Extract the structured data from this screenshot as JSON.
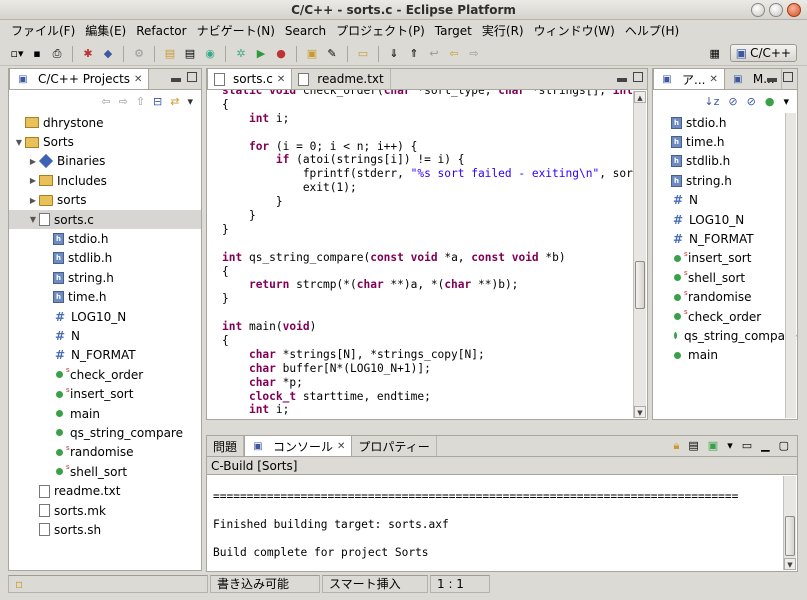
{
  "window": {
    "title": "C/C++ - sorts.c - Eclipse Platform"
  },
  "menubar": [
    "ファイル(F)",
    "編集(E)",
    "Refactor",
    "ナビゲート(N)",
    "Search",
    "プロジェクト(P)",
    "Target",
    "実行(R)",
    "ウィンドウ(W)",
    "ヘルプ(H)"
  ],
  "perspective": {
    "label": "C/C++"
  },
  "projects_view": {
    "title": "C/C++ Projects",
    "tree": [
      {
        "label": "dhrystone",
        "indent": 1,
        "icon": "project-icon",
        "twisty": ""
      },
      {
        "label": "Sorts",
        "indent": 1,
        "icon": "project-icon",
        "twisty": "▼"
      },
      {
        "label": "Binaries",
        "indent": 2,
        "icon": "binaries-icon",
        "twisty": "▶"
      },
      {
        "label": "Includes",
        "indent": 2,
        "icon": "includes-icon",
        "twisty": "▶"
      },
      {
        "label": "sorts",
        "indent": 2,
        "icon": "folder-icon",
        "twisty": "▶"
      },
      {
        "label": "sorts.c",
        "indent": 2,
        "icon": "c-file-icon",
        "twisty": "▼",
        "selected": true
      },
      {
        "label": "stdio.h",
        "indent": 3,
        "icon": "header-icon",
        "twisty": ""
      },
      {
        "label": "stdlib.h",
        "indent": 3,
        "icon": "header-icon",
        "twisty": ""
      },
      {
        "label": "string.h",
        "indent": 3,
        "icon": "header-icon",
        "twisty": ""
      },
      {
        "label": "time.h",
        "indent": 3,
        "icon": "header-icon",
        "twisty": ""
      },
      {
        "label": "LOG10_N",
        "indent": 3,
        "icon": "macro-icon",
        "twisty": ""
      },
      {
        "label": "N",
        "indent": 3,
        "icon": "macro-icon",
        "twisty": ""
      },
      {
        "label": "N_FORMAT",
        "indent": 3,
        "icon": "macro-icon",
        "twisty": ""
      },
      {
        "label": "check_order",
        "indent": 3,
        "icon": "static-function-icon",
        "twisty": ""
      },
      {
        "label": "insert_sort",
        "indent": 3,
        "icon": "static-function-icon",
        "twisty": ""
      },
      {
        "label": "main",
        "indent": 3,
        "icon": "function-icon",
        "twisty": ""
      },
      {
        "label": "qs_string_compare",
        "indent": 3,
        "icon": "function-icon",
        "twisty": ""
      },
      {
        "label": "randomise",
        "indent": 3,
        "icon": "static-function-icon",
        "twisty": ""
      },
      {
        "label": "shell_sort",
        "indent": 3,
        "icon": "static-function-icon",
        "twisty": ""
      },
      {
        "label": "readme.txt",
        "indent": 2,
        "icon": "text-file-icon",
        "twisty": ""
      },
      {
        "label": "sorts.mk",
        "indent": 2,
        "icon": "makefile-icon",
        "twisty": ""
      },
      {
        "label": "sorts.sh",
        "indent": 2,
        "icon": "script-file-icon",
        "twisty": ""
      }
    ]
  },
  "editor": {
    "tabs": [
      {
        "label": "sorts.c",
        "active": true
      },
      {
        "label": "readme.txt",
        "active": false
      }
    ],
    "lines": [
      "static void check_order(char *sort_type, char *strings[], int n)",
      "{",
      "    int i;",
      "",
      "    for (i = 0; i < n; i++) {",
      "        if (atoi(strings[i]) != i) {",
      "            fprintf(stderr, \"%s sort failed - exiting\\n\", sort_ty",
      "            exit(1);",
      "        }",
      "    }",
      "}",
      "",
      "int qs_string_compare(const void *a, const void *b)",
      "{",
      "    return strcmp(*(char **)a, *(char **)b);",
      "}",
      "",
      "int main(void)",
      "{",
      "    char *strings[N], *strings_copy[N];",
      "    char buffer[N*(LOG10_N+1)];",
      "    char *p;",
      "    clock_t starttime, endtime;",
      "    int i;"
    ]
  },
  "outline_view": {
    "tabs": [
      {
        "label": "ア..."
      },
      {
        "label": "M..."
      }
    ],
    "items": [
      {
        "label": "stdio.h",
        "icon": "header-icon"
      },
      {
        "label": "time.h",
        "icon": "header-icon"
      },
      {
        "label": "stdlib.h",
        "icon": "header-icon"
      },
      {
        "label": "string.h",
        "icon": "header-icon"
      },
      {
        "label": "N",
        "icon": "macro-icon"
      },
      {
        "label": "LOG10_N",
        "icon": "macro-icon"
      },
      {
        "label": "N_FORMAT",
        "icon": "macro-icon"
      },
      {
        "label": "insert_sort",
        "icon": "static-function-icon"
      },
      {
        "label": "shell_sort",
        "icon": "static-function-icon"
      },
      {
        "label": "randomise",
        "icon": "static-function-icon"
      },
      {
        "label": "check_order",
        "icon": "static-function-icon"
      },
      {
        "label": "qs_string_compare",
        "icon": "function-icon"
      },
      {
        "label": "main",
        "icon": "function-icon"
      }
    ]
  },
  "bottom_panel": {
    "tabs": [
      {
        "label": "問題"
      },
      {
        "label": "コンソール",
        "active": true
      },
      {
        "label": "プロパティー"
      }
    ],
    "console_title": "C-Build [Sorts]",
    "console_lines": [
      "",
      "==============================================================================",
      "",
      "Finished building target: sorts.axf",
      "",
      "Build complete for project Sorts"
    ]
  },
  "statusbar": {
    "writable": "書き込み可能",
    "insert_mode": "スマート挿入",
    "position": "1 : 1"
  },
  "colors": {
    "keyword": "#7f0055",
    "string": "#2a00ff",
    "selection": "#d8d6d2"
  }
}
